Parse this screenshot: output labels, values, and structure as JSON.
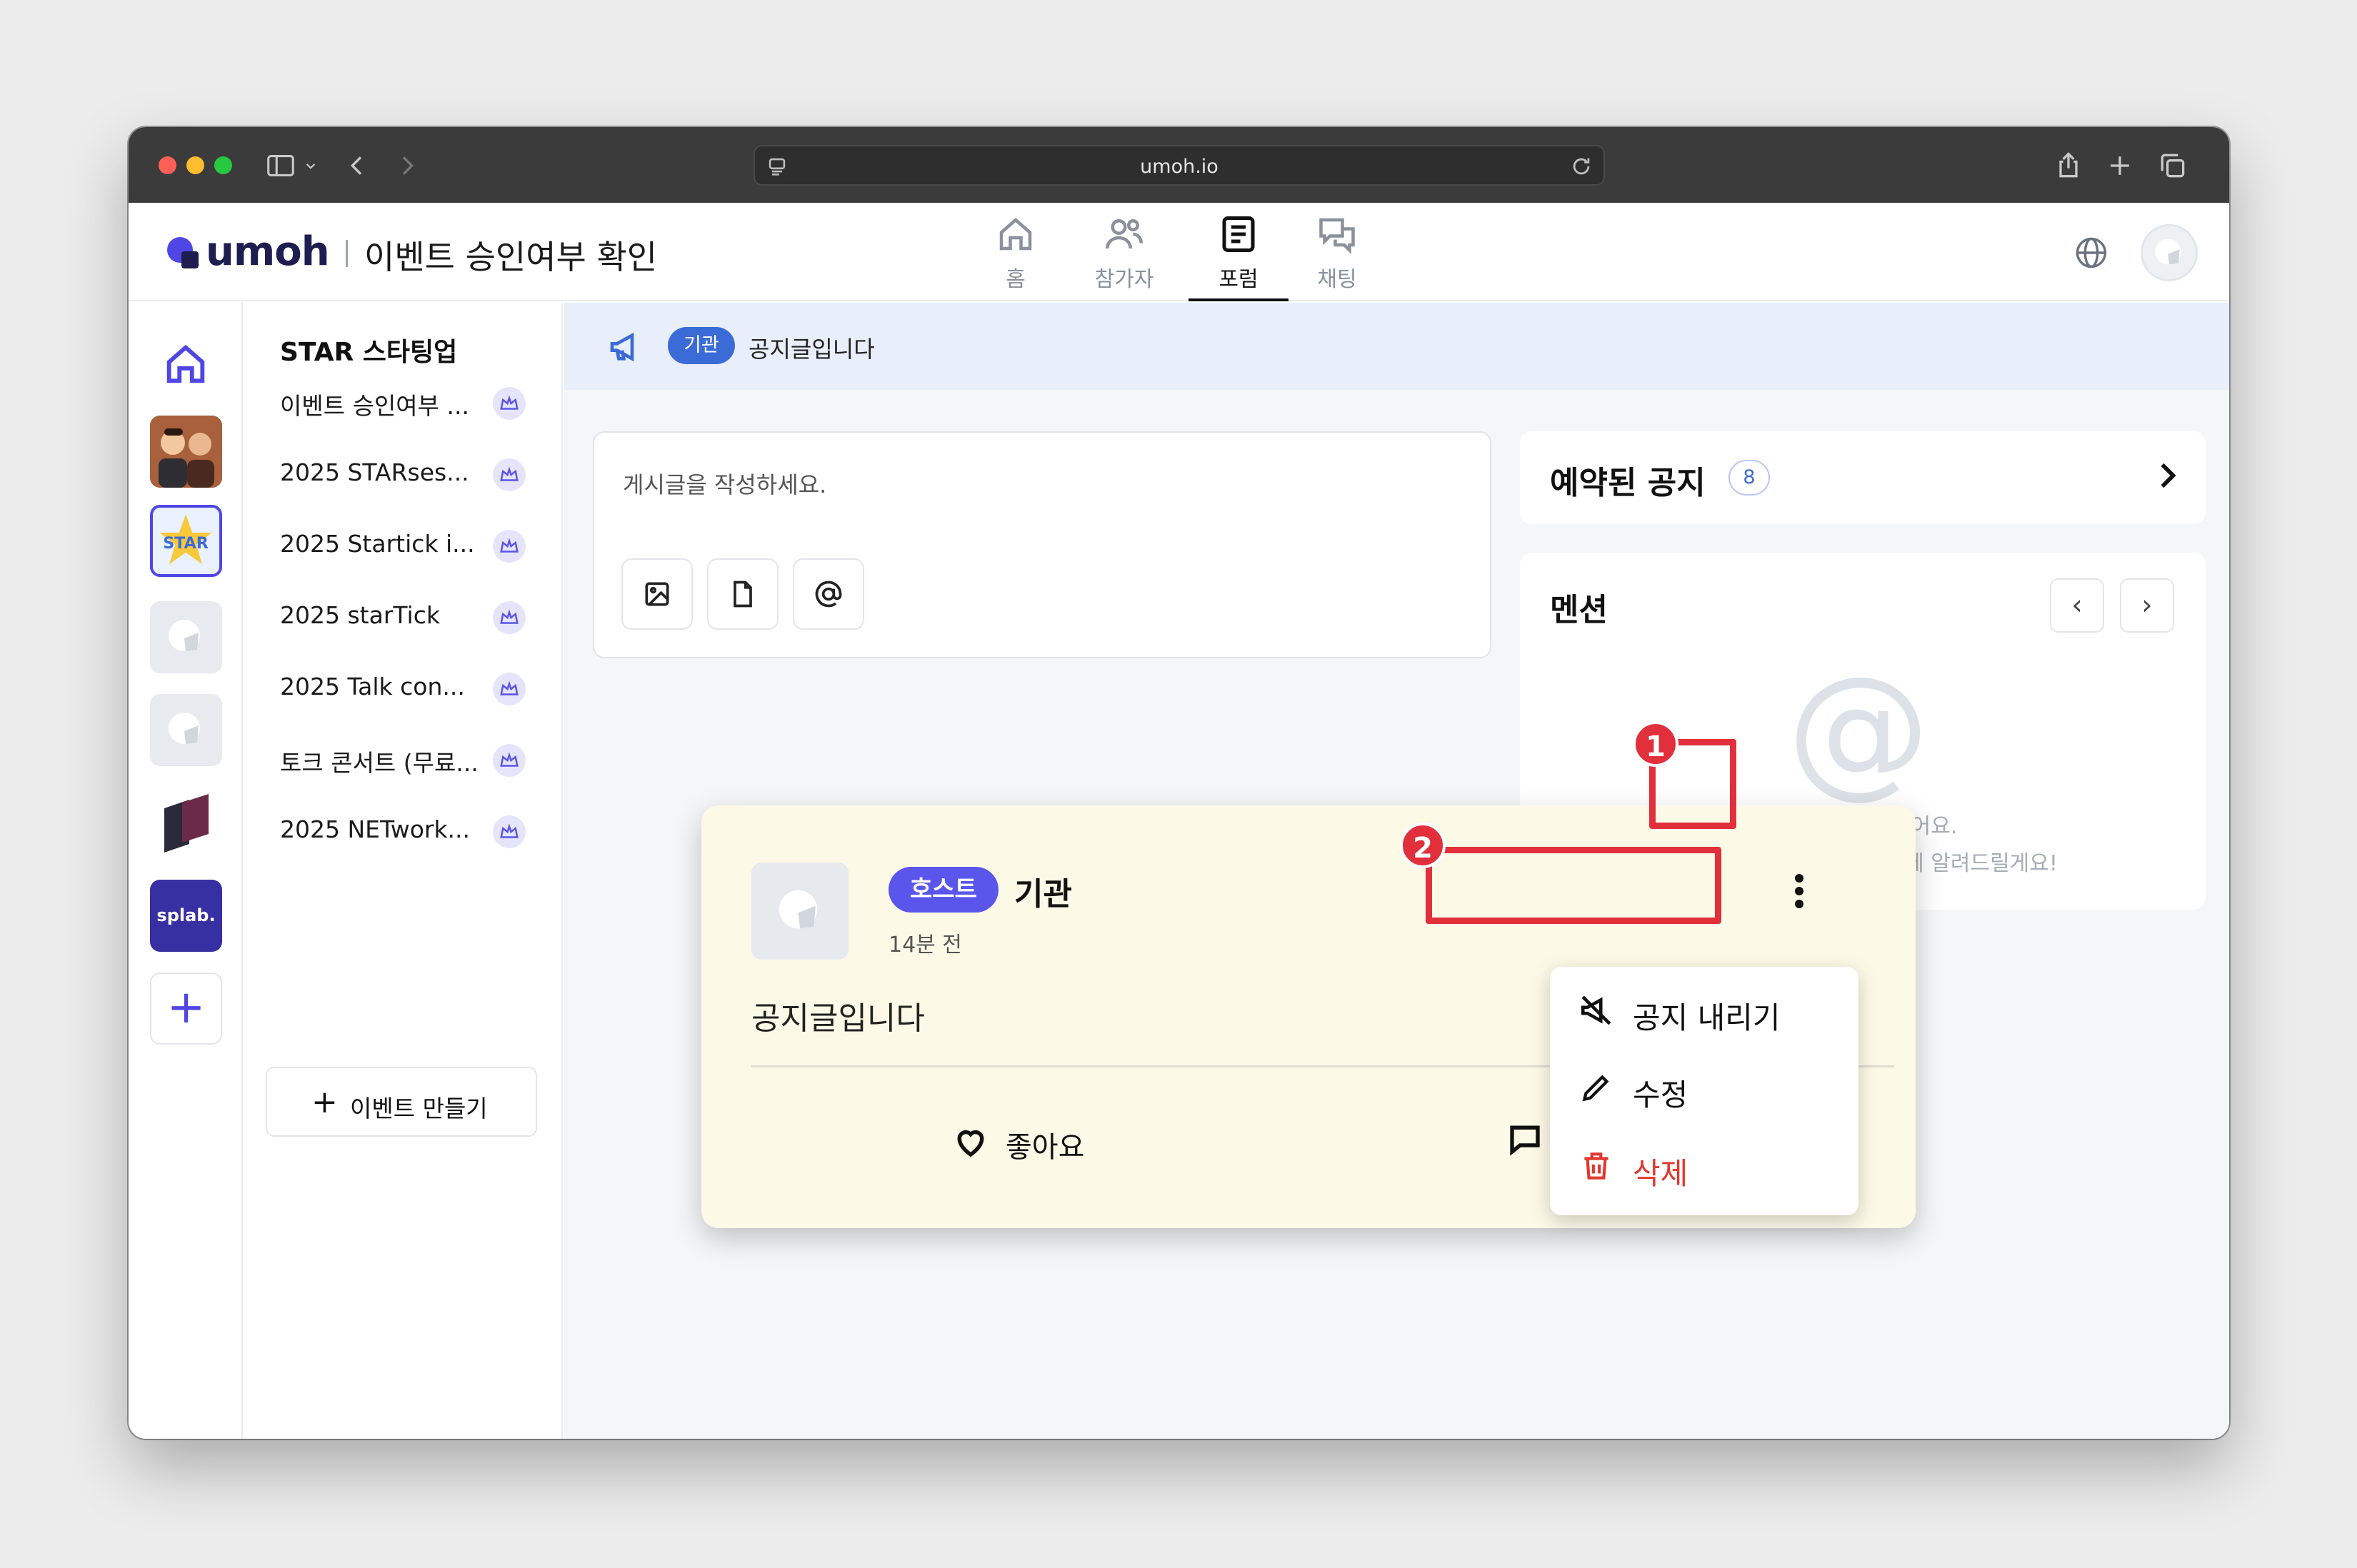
{
  "browser": {
    "url": "umoh.io"
  },
  "app": {
    "logo_text": "umoh",
    "page_title": "이벤트 승인여부 확인",
    "nav": [
      {
        "label": "홈",
        "icon": "home-icon"
      },
      {
        "label": "참가자",
        "icon": "users-icon"
      },
      {
        "label": "포럼",
        "icon": "forum-icon",
        "active": true
      },
      {
        "label": "채팅",
        "icon": "chat-icon"
      }
    ],
    "rail_splab_label": "splab."
  },
  "event_list": {
    "group_title": "STAR 스타팅업",
    "group_chevron": "›",
    "items": [
      {
        "label": "이벤트 승인여부 ..."
      },
      {
        "label": "2025 STARses..."
      },
      {
        "label": "2025 Startick i..."
      },
      {
        "label": "2025 starTick"
      },
      {
        "label": "2025 Talk con..."
      },
      {
        "label": "토크 콘서트 (무료..."
      },
      {
        "label": "2025 NETwork..."
      }
    ],
    "create_label": "이벤트 만들기",
    "create_plus": "+"
  },
  "notice": {
    "pill": "기관",
    "text": "공지글입니다"
  },
  "composer": {
    "placeholder": "게시글을 작성하세요.",
    "tools": [
      "image-icon",
      "file-icon",
      "mention-icon"
    ]
  },
  "reserved": {
    "title": "예약된 공지",
    "count": "8"
  },
  "mentions": {
    "title": "멘션",
    "prev": "‹",
    "next": "›",
    "at_symbol": "@",
    "empty_line1": "멘션 활동이 없어요.",
    "empty_line2": "멘션하면 여기에 알려드릴게요!"
  },
  "post": {
    "host_badge": "호스트",
    "author": "기관",
    "time": "14분 전",
    "body": "공지글입니다",
    "like_label": "좋아요"
  },
  "dropdown": {
    "unpin_label": "공지 내리기",
    "edit_label": "수정",
    "delete_label": "삭제"
  },
  "annotations": {
    "step1": "1",
    "step2": "2",
    "highlight_color": "#e1303c"
  },
  "colors": {
    "brand": "#4f46e5",
    "notice_blue": "#3b6bd6",
    "post_bg": "#fdf9e7",
    "delete_red": "#e0382f"
  }
}
